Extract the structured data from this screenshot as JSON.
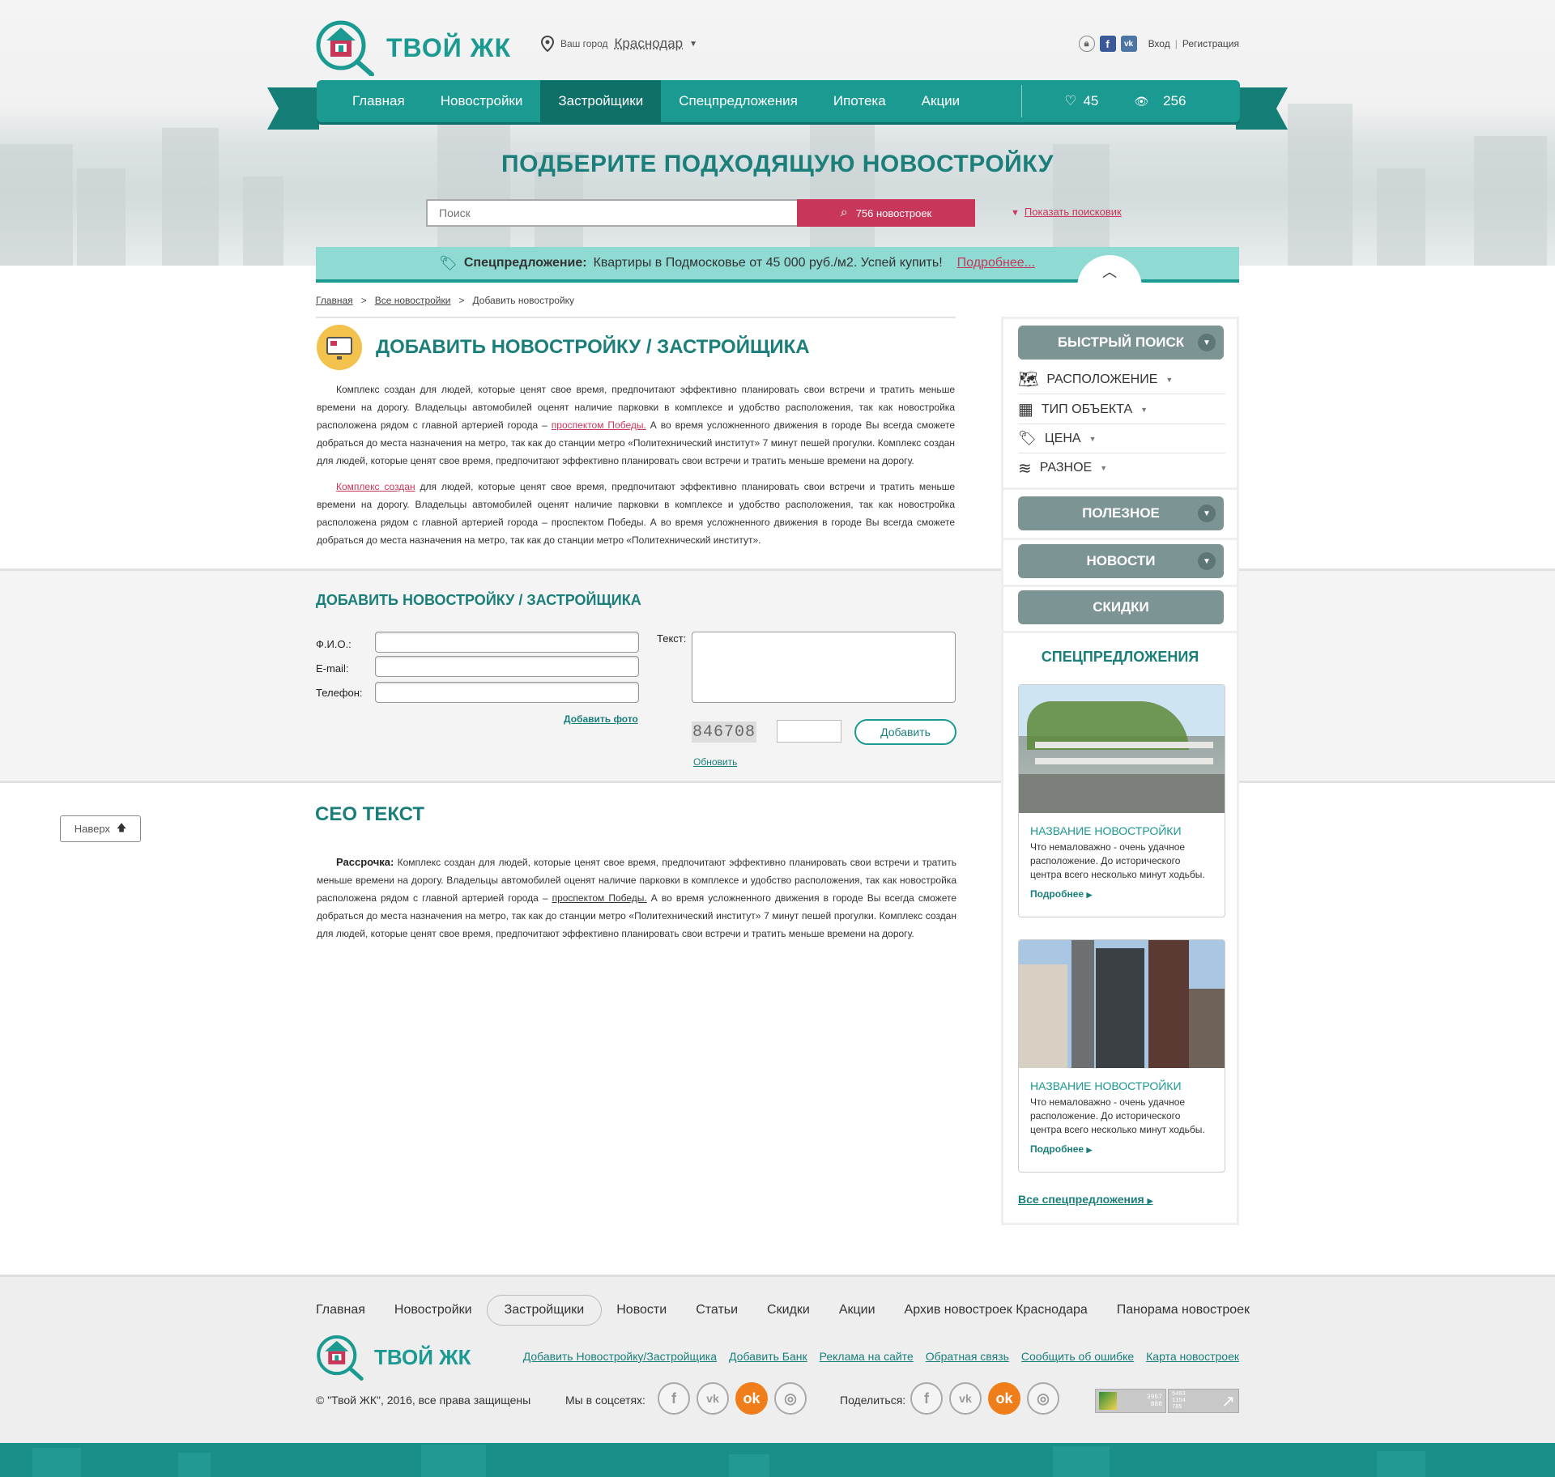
{
  "header": {
    "logo_text": "ТВОЙ ЖК",
    "city_label": "Ваш город",
    "city_name": "Краснодар",
    "login": "Вход",
    "separator": "|",
    "register": "Регистрация"
  },
  "nav": {
    "items": [
      "Главная",
      "Новостройки",
      "Застройщики",
      "Спецпредложения",
      "Ипотека",
      "Акции"
    ],
    "favorites_count": "45",
    "views_count": "256"
  },
  "hero": {
    "headline": "ПОДБЕРИТЕ ПОДХОДЯЩУЮ НОВОСТРОЙКУ",
    "search_placeholder": "Поиск",
    "search_button": "756 новостроек",
    "show_search": "Показать поисковик"
  },
  "promo": {
    "label": "Спецпредложение:",
    "text": "Квартиры в Подмосковье от 45 000 руб./м2. Успей купить!",
    "more": "Подробнее..."
  },
  "breadcrumbs": {
    "home": "Главная",
    "sep": ">",
    "all": "Все новостройки",
    "current": "Добавить новостройку"
  },
  "page": {
    "title": "ДОБАВИТЬ НОВОСТРОЙКУ / ЗАСТРОЙЩИКА",
    "p1_a": "Комплекс создан для людей, которые ценят свое время, предпочитают эффективно планировать свои встречи и тратить меньше времени на дорогу. Владельцы автомобилей оценят наличие парковки в комплексе и удобство расположения, так как новостройка расположена рядом с главной артерией города – ",
    "p1_link": "проспектом Победы.",
    "p1_b": " А во время усложненного движения в городе Вы всегда сможете добраться до места назначения на метро, так как до станции метро «Политехнический институт» 7 минут пешей прогулки. Комплекс создан для людей, которые ценят свое время, предпочитают эффективно планировать свои встречи и тратить меньше времени на дорогу.",
    "p2_link": "Комплекс создан",
    "p2_b": " для людей, которые ценят свое время, предпочитают эффективно планировать свои встречи и тратить меньше времени на дорогу. Владельцы автомобилей оценят наличие парковки в комплексе и удобство расположения, так как новостройка расположена рядом с главной артерией города – проспектом Победы. А во время усложненного движения в городе Вы всегда сможете добраться до места назначения на метро, так как до станции метро «Политехнический институт»."
  },
  "form": {
    "title": "ДОБАВИТЬ НОВОСТРОЙКУ / ЗАСТРОЙЩИКА",
    "fio_label": "Ф.И.О.:",
    "email_label": "E-mail:",
    "phone_label": "Телефон:",
    "text_label": "Текст:",
    "add_photo": "Добавить фото",
    "captcha": "846708",
    "refresh": "Обновить",
    "submit": "Добавить"
  },
  "seo": {
    "title": "СЕО ТЕКСТ",
    "bold": "Рассрочка:",
    "text_a": " Комплекс создан для людей, которые ценят свое время, предпочитают эффективно планировать свои встречи и тратить меньше времени на дорогу. Владельцы автомобилей оценят наличие парковки в комплексе и удобство расположения, так как новостройка расположена рядом с главной артерией города – ",
    "link": "проспектом Победы.",
    "text_b": " А во время усложненного движения в городе Вы всегда сможете добраться до места назначения на метро, так как до станции метро «Политехнический институт» 7 минут пешей прогулки. Комплекс создан для людей, которые ценят свое время, предпочитают эффективно планировать свои встречи и тратить меньше времени на дорогу."
  },
  "to_top": "Наверх",
  "sidebar": {
    "quick_search": "БЫСТРЫЙ ПОИСК",
    "filters": [
      "РАСПОЛОЖЕНИЕ",
      "ТИП ОБЪЕКТА",
      "ЦЕНА",
      "РАЗНОЕ"
    ],
    "useful": "ПОЛЕЗНОЕ",
    "news": "НОВОСТИ",
    "discounts": "СКИДКИ",
    "special_title": "СПЕЦПРЕДЛОЖЕНИЯ",
    "cards": [
      {
        "name": "НАЗВАНИЕ НОВОСТРОЙКИ",
        "desc": "Что немаловажно - очень удачное расположение. До исторического центра всего несколько минут ходьбы.",
        "more": "Подробнее"
      },
      {
        "name": "НАЗВАНИЕ НОВОСТРОЙКИ",
        "desc": "Что немаловажно - очень удачное расположение. До исторического центра всего несколько минут ходьбы.",
        "more": "Подробнее"
      }
    ],
    "all_special": "Все спецпредложения"
  },
  "footer": {
    "nav": [
      "Главная",
      "Новостройки",
      "Застройщики",
      "Новости",
      "Статьи",
      "Скидки",
      "Акции",
      "Архив новостроек Краснодара",
      "Панорама новостроек"
    ],
    "logo_text": "ТВОЙ ЖК",
    "links": [
      "Добавить Новостройку/Застройщика",
      "Добавить Банк",
      "Реклама на сайте",
      "Обратная связь",
      "Сообщить об ошибке",
      "Карта новостроек"
    ],
    "copyright": "© \"Твой ЖК\", 2016, все права защищены",
    "social_label": "Мы в соцсетях:",
    "share_label": "Поделиться:",
    "counter_a": "3967",
    "counter_b": "888",
    "counter_c": "5493",
    "counter_d": "1154",
    "counter_e": "785"
  },
  "colors": {
    "teal": "#1a9a91",
    "teal_dark": "#0f6f69",
    "accent_red": "#c8375a",
    "promo_bg": "#8fdad2",
    "sidebar_btn": "#7d9495",
    "ok_orange": "#ef7d1a"
  }
}
